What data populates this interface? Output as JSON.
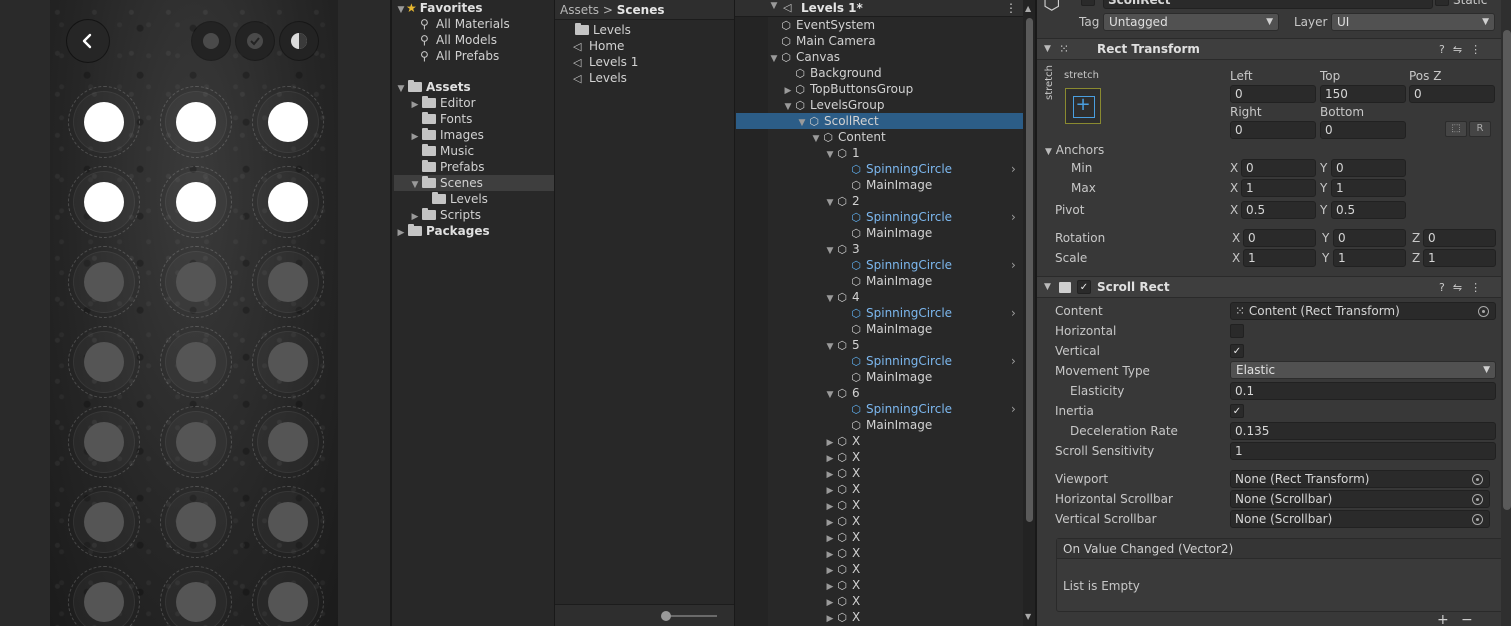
{
  "game": {
    "back_icon": "chevron-left-icon",
    "top_buttons": [
      "record-dot-icon",
      "check-circle-icon",
      "half-circle-icon"
    ],
    "level_rows": [
      [
        true,
        true,
        true
      ],
      [
        true,
        true,
        true
      ],
      [
        false,
        false,
        false
      ],
      [
        false,
        false,
        false
      ],
      [
        false,
        false,
        false
      ],
      [
        false,
        false,
        false
      ],
      [
        false,
        false,
        false
      ]
    ]
  },
  "project": {
    "favorites_label": "Favorites",
    "favorites": [
      "All Materials",
      "All Models",
      "All Prefabs"
    ],
    "assets_label": "Assets",
    "assets_folders": [
      "Editor",
      "Fonts",
      "Images",
      "Music",
      "Prefabs",
      "Scenes",
      "Scripts"
    ],
    "scenes_child": "Levels",
    "packages_label": "Packages"
  },
  "files": {
    "breadcrumb_root": "Assets",
    "breadcrumb_sep": ">",
    "breadcrumb_current": "Scenes",
    "items": [
      {
        "label": "Levels",
        "icon": "folder-icon"
      },
      {
        "label": "Home",
        "icon": "unity-scene-icon"
      },
      {
        "label": "Levels 1",
        "icon": "unity-scene-icon"
      },
      {
        "label": "Levels",
        "icon": "unity-scene-icon"
      }
    ]
  },
  "hierarchy": {
    "scene_title": "Levels 1*",
    "rows": [
      {
        "label": "EventSystem",
        "depth": 1,
        "arrow": "",
        "prefab": false
      },
      {
        "label": "Main Camera",
        "depth": 1,
        "arrow": "",
        "prefab": false
      },
      {
        "label": "Canvas",
        "depth": 1,
        "arrow": "▼",
        "prefab": false
      },
      {
        "label": "Background",
        "depth": 2,
        "arrow": "",
        "prefab": false
      },
      {
        "label": "TopButtonsGroup",
        "depth": 2,
        "arrow": "▶",
        "prefab": false
      },
      {
        "label": "LevelsGroup",
        "depth": 2,
        "arrow": "▼",
        "prefab": false
      },
      {
        "label": "ScollRect",
        "depth": 3,
        "arrow": "▼",
        "prefab": false,
        "selected": true
      },
      {
        "label": "Content",
        "depth": 4,
        "arrow": "▼",
        "prefab": false
      },
      {
        "label": "1",
        "depth": 5,
        "arrow": "▼",
        "prefab": false
      },
      {
        "label": "SpinningCircle",
        "depth": 6,
        "arrow": "",
        "prefab": true
      },
      {
        "label": "MainImage",
        "depth": 6,
        "arrow": "",
        "prefab": false
      },
      {
        "label": "2",
        "depth": 5,
        "arrow": "▼",
        "prefab": false
      },
      {
        "label": "SpinningCircle",
        "depth": 6,
        "arrow": "",
        "prefab": true
      },
      {
        "label": "MainImage",
        "depth": 6,
        "arrow": "",
        "prefab": false
      },
      {
        "label": "3",
        "depth": 5,
        "arrow": "▼",
        "prefab": false
      },
      {
        "label": "SpinningCircle",
        "depth": 6,
        "arrow": "",
        "prefab": true
      },
      {
        "label": "MainImage",
        "depth": 6,
        "arrow": "",
        "prefab": false
      },
      {
        "label": "4",
        "depth": 5,
        "arrow": "▼",
        "prefab": false
      },
      {
        "label": "SpinningCircle",
        "depth": 6,
        "arrow": "",
        "prefab": true
      },
      {
        "label": "MainImage",
        "depth": 6,
        "arrow": "",
        "prefab": false
      },
      {
        "label": "5",
        "depth": 5,
        "arrow": "▼",
        "prefab": false
      },
      {
        "label": "SpinningCircle",
        "depth": 6,
        "arrow": "",
        "prefab": true
      },
      {
        "label": "MainImage",
        "depth": 6,
        "arrow": "",
        "prefab": false
      },
      {
        "label": "6",
        "depth": 5,
        "arrow": "▼",
        "prefab": false
      },
      {
        "label": "SpinningCircle",
        "depth": 6,
        "arrow": "",
        "prefab": true
      },
      {
        "label": "MainImage",
        "depth": 6,
        "arrow": "",
        "prefab": false
      },
      {
        "label": "X",
        "depth": 5,
        "arrow": "▶",
        "prefab": false
      },
      {
        "label": "X",
        "depth": 5,
        "arrow": "▶",
        "prefab": false
      },
      {
        "label": "X",
        "depth": 5,
        "arrow": "▶",
        "prefab": false
      },
      {
        "label": "X",
        "depth": 5,
        "arrow": "▶",
        "prefab": false
      },
      {
        "label": "X",
        "depth": 5,
        "arrow": "▶",
        "prefab": false
      },
      {
        "label": "X",
        "depth": 5,
        "arrow": "▶",
        "prefab": false
      },
      {
        "label": "X",
        "depth": 5,
        "arrow": "▶",
        "prefab": false
      },
      {
        "label": "X",
        "depth": 5,
        "arrow": "▶",
        "prefab": false
      },
      {
        "label": "X",
        "depth": 5,
        "arrow": "▶",
        "prefab": false
      },
      {
        "label": "X",
        "depth": 5,
        "arrow": "▶",
        "prefab": false
      },
      {
        "label": "X",
        "depth": 5,
        "arrow": "▶",
        "prefab": false
      },
      {
        "label": "X",
        "depth": 5,
        "arrow": "▶",
        "prefab": false
      }
    ]
  },
  "inspector": {
    "object_name": "ScollRect",
    "static_label": "Static",
    "tag_label": "Tag",
    "tag_value": "Untagged",
    "layer_label": "Layer",
    "layer_value": "UI",
    "rect_transform": {
      "title": "Rect Transform",
      "stretch_top": "stretch",
      "stretch_side": "stretch",
      "left_label": "Left",
      "left": "0",
      "top_label": "Top",
      "top": "150",
      "posz_label": "Pos Z",
      "posz": "0",
      "right_label": "Right",
      "right": "0",
      "bottom_label": "Bottom",
      "bottom": "0",
      "r_button": "R",
      "anchors_label": "Anchors",
      "min_label": "Min",
      "min_x": "0",
      "min_y": "0",
      "max_label": "Max",
      "max_x": "1",
      "max_y": "1",
      "pivot_label": "Pivot",
      "pivot_x": "0.5",
      "pivot_y": "0.5",
      "rotation_label": "Rotation",
      "rot_x": "0",
      "rot_y": "0",
      "rot_z": "0",
      "scale_label": "Scale",
      "scale_x": "1",
      "scale_y": "1",
      "scale_z": "1",
      "x": "X",
      "y": "Y",
      "z": "Z"
    },
    "scroll_rect": {
      "title": "Scroll Rect",
      "content_label": "Content",
      "content_value": "Content (Rect Transform)",
      "horizontal_label": "Horizontal",
      "horizontal": false,
      "vertical_label": "Vertical",
      "vertical": true,
      "movement_label": "Movement Type",
      "movement_value": "Elastic",
      "elasticity_label": "Elasticity",
      "elasticity": "0.1",
      "inertia_label": "Inertia",
      "inertia": true,
      "decel_label": "Deceleration Rate",
      "decel": "0.135",
      "sensitivity_label": "Scroll Sensitivity",
      "sensitivity": "1",
      "viewport_label": "Viewport",
      "viewport_value": "None (Rect Transform)",
      "hscroll_label": "Horizontal Scrollbar",
      "hscroll_value": "None (Scrollbar)",
      "vscroll_label": "Vertical Scrollbar",
      "vscroll_value": "None (Scrollbar)",
      "event_title": "On Value Changed (Vector2)",
      "event_empty": "List is Empty",
      "add": "+",
      "remove": "−"
    }
  },
  "colors": {
    "selection": "#2c5d87",
    "prefab_blue": "#7cb7ee",
    "star": "#e8b830"
  }
}
